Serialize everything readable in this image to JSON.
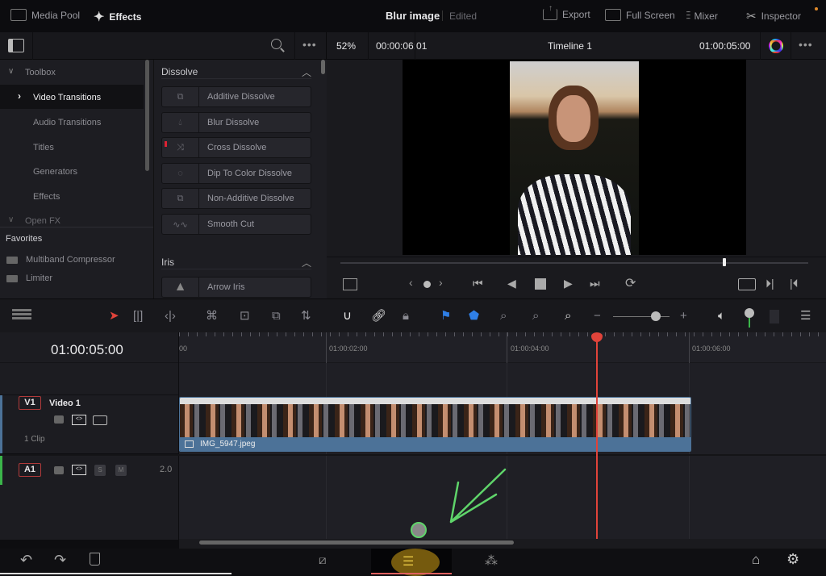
{
  "topbar": {
    "media_pool": "Media Pool",
    "effects": "Effects",
    "project_title": "Blur image",
    "status": "Edited",
    "export": "Export",
    "full_screen": "Full Screen",
    "mixer": "Mixer",
    "inspector": "Inspector"
  },
  "viewer_bar": {
    "zoom": "52%",
    "duration": "00:00:06:01",
    "timeline_name": "Timeline 1",
    "timecode": "01:00:05:00"
  },
  "toolbox": {
    "header": "Toolbox",
    "items": [
      {
        "label": "Video Transitions",
        "selected": true
      },
      {
        "label": "Audio Transitions"
      },
      {
        "label": "Titles"
      },
      {
        "label": "Generators"
      },
      {
        "label": "Effects"
      }
    ],
    "open_fx": "Open FX",
    "favorites_header": "Favorites",
    "favorites": [
      "Multiband Compressor",
      "Limiter"
    ]
  },
  "effects_list": {
    "dissolve_header": "Dissolve",
    "dissolve": [
      "Additive Dissolve",
      "Blur Dissolve",
      "Cross Dissolve",
      "Dip To Color Dissolve",
      "Non-Additive Dissolve",
      "Smooth Cut"
    ],
    "iris_header": "Iris",
    "iris": [
      "Arrow Iris"
    ]
  },
  "playback": {
    "scrub_progress": 0.82
  },
  "timeline": {
    "current_timecode": "01:00:05:00",
    "ruler_labels": [
      "01:00:02:00",
      "01:00:04:00",
      "01:00:06:00"
    ],
    "ruler_start_fragment": "00",
    "video_track": {
      "badge": "V1",
      "name": "Video 1",
      "clip_count": "1 Clip"
    },
    "audio_track": {
      "badge": "A1",
      "solo": "S",
      "mute": "M",
      "channels": "2.0"
    },
    "clip_name": "IMG_5947.jpeg",
    "zoom_slider": 0.75
  },
  "colors": {
    "playhead": "#e0433a",
    "clip_bar": "#4c7298",
    "accent_blue": "#2f7fe6",
    "green_track": "#3bb54a",
    "annotation": "#5fd46a"
  }
}
